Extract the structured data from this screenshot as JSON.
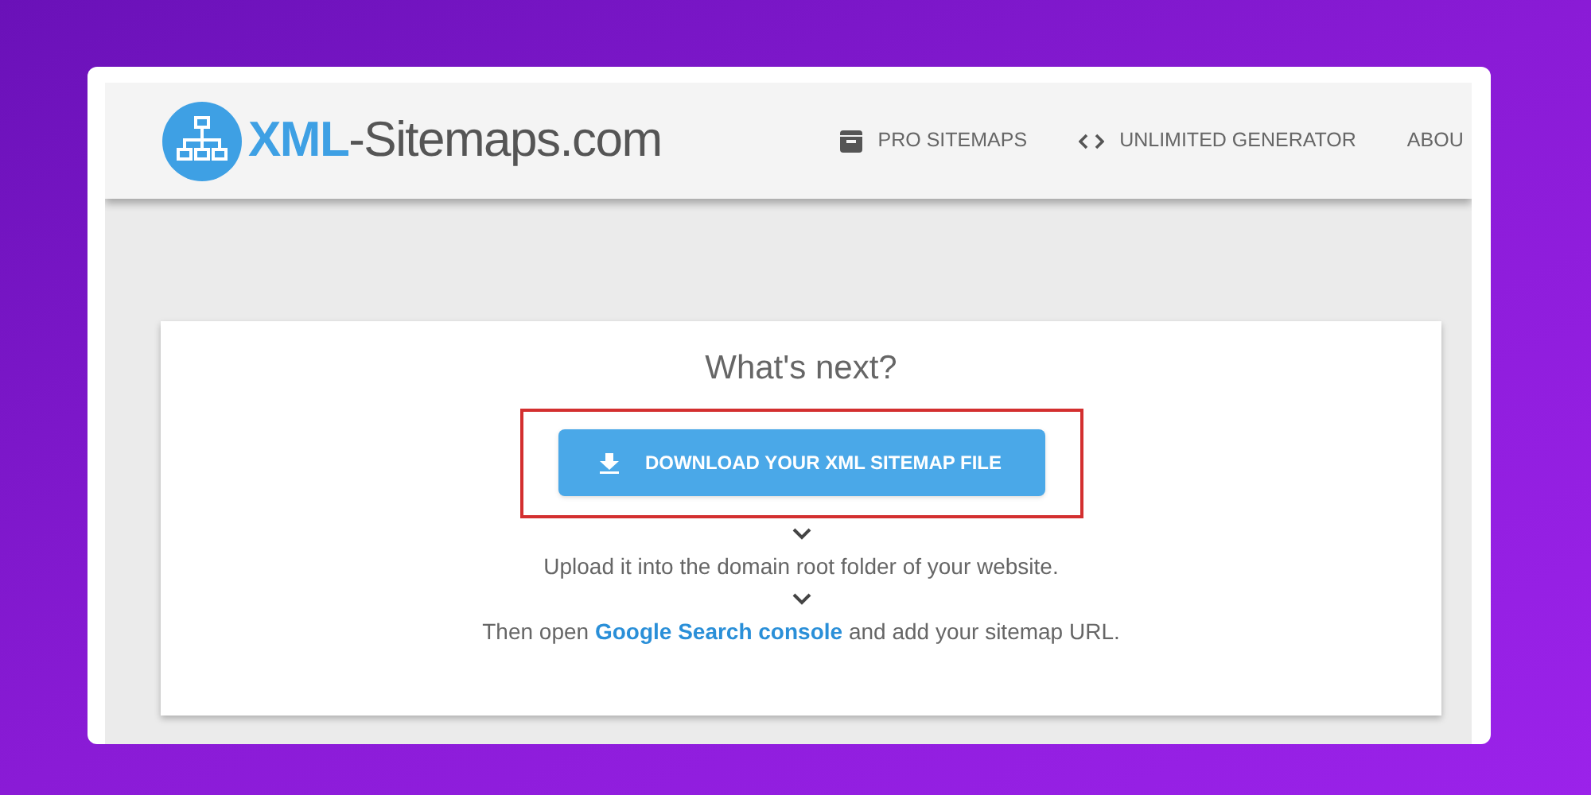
{
  "header": {
    "logo": {
      "highlight": "XML",
      "rest": "-Sitemaps.com"
    },
    "nav": [
      {
        "kind": "box",
        "label": "PRO SITEMAPS"
      },
      {
        "kind": "code",
        "label": "UNLIMITED GENERATOR"
      },
      {
        "kind": "none",
        "label": "ABOU"
      }
    ]
  },
  "card": {
    "title": "What's next?",
    "highlighted": true,
    "button": "DOWNLOAD YOUR XML SITEMAP FILE",
    "steps": [
      {
        "text": "Upload it into the domain root folder of your website."
      },
      {
        "before": "Then open ",
        "link": "Google Search console",
        "after": " and add your sitemap URL."
      }
    ]
  }
}
